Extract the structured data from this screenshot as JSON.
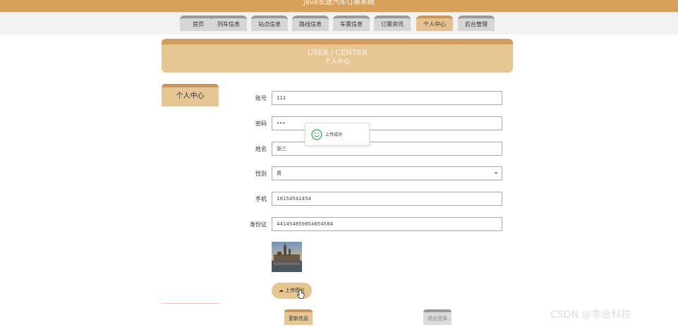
{
  "app": {
    "title": "Java长途汽车订票系统"
  },
  "nav": {
    "items": [
      {
        "label": "首页"
      },
      {
        "label": "列车信息"
      },
      {
        "label": "站点信息"
      },
      {
        "label": "路线信息"
      },
      {
        "label": "车票信息"
      },
      {
        "label": "订票资讯"
      },
      {
        "label": "个人中心"
      },
      {
        "label": "后台管理"
      }
    ],
    "active_index": 6
  },
  "banner": {
    "en": "USER / CENTER",
    "cn": "个人中心"
  },
  "sidebar": {
    "items": [
      {
        "label": "个人中心"
      }
    ]
  },
  "form": {
    "account": {
      "label": "账号",
      "value": "111"
    },
    "password": {
      "label": "密码",
      "value": "•••"
    },
    "name": {
      "label": "姓名",
      "value": "张三"
    },
    "gender": {
      "label": "性别",
      "value": "男"
    },
    "phone": {
      "label": "手机",
      "value": "18154541454"
    },
    "idcard": {
      "label": "身份证",
      "value": "441454859854654584"
    }
  },
  "upload": {
    "label": "上传图片"
  },
  "buttons": {
    "update": "更新信息",
    "logout": "退出登录"
  },
  "toast": {
    "text": "上传成功"
  },
  "watermark": {
    "text": "CSDN @李会科技"
  },
  "colors": {
    "brand": "#d9a05b",
    "accent": "#e6c692",
    "success": "#2bb36b"
  },
  "icons": {
    "toast": "smile-success-icon",
    "upload": "cloud-upload-icon",
    "cursor": "hand-pointer-icon"
  }
}
